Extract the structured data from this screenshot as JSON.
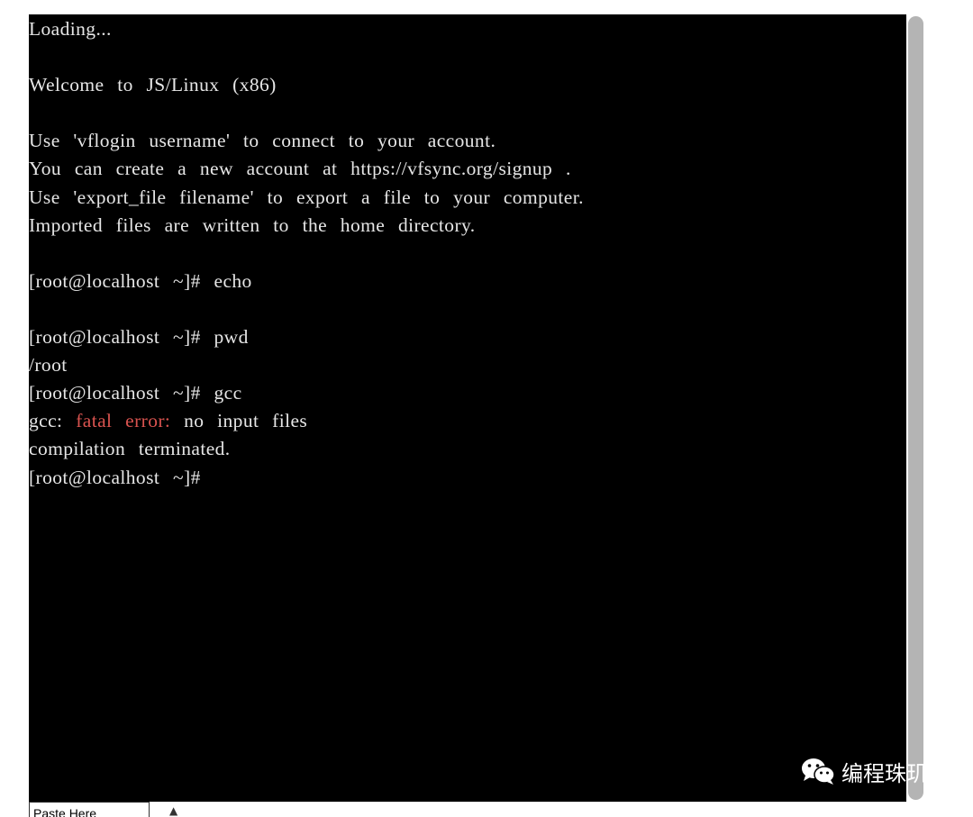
{
  "terminal": {
    "lines": [
      [
        {
          "text": "Loading..."
        }
      ],
      [],
      [
        {
          "text": "Welcome to JS/Linux (x86)"
        }
      ],
      [],
      [
        {
          "text": "Use 'vflogin username' to connect to your account."
        }
      ],
      [
        {
          "text": "You can create a new account at https://vfsync.org/signup ."
        }
      ],
      [
        {
          "text": "Use 'export_file filename' to export a file to your computer."
        }
      ],
      [
        {
          "text": "Imported files are written to the home directory."
        }
      ],
      [],
      [
        {
          "text": "[root@localhost ~]# echo"
        }
      ],
      [],
      [
        {
          "text": "[root@localhost ~]# pwd"
        }
      ],
      [
        {
          "text": "/root"
        }
      ],
      [
        {
          "text": "[root@localhost ~]# gcc"
        }
      ],
      [
        {
          "text": "gcc: "
        },
        {
          "text": "fatal error:",
          "color": "red"
        },
        {
          "text": " no input files"
        }
      ],
      [
        {
          "text": "compilation terminated."
        }
      ],
      [
        {
          "text": "[root@localhost ~]#"
        }
      ]
    ],
    "error_color": "#d9534f",
    "text_color": "#e6e6e6",
    "background": "#000000"
  },
  "footer": {
    "tab_label": "Paste Here",
    "arrow_icon": "up-arrow-icon"
  },
  "watermark": {
    "text": "编程珠玑",
    "icon": "wechat-logo-icon"
  }
}
